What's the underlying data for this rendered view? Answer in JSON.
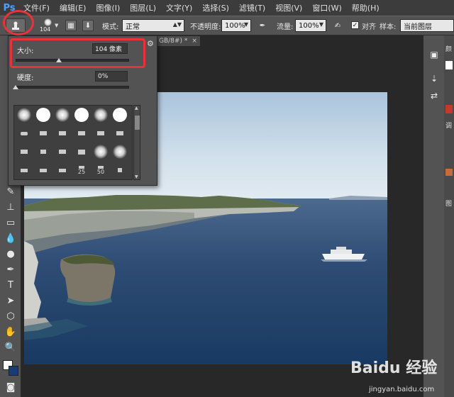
{
  "app": {
    "logo": "Ps"
  },
  "menubar": {
    "items": [
      "文件(F)",
      "编辑(E)",
      "图像(I)",
      "图层(L)",
      "文字(Y)",
      "选择(S)",
      "滤镜(T)",
      "视图(V)",
      "窗口(W)",
      "帮助(H)"
    ]
  },
  "options": {
    "brush_size": "104",
    "mode_label": "模式:",
    "mode_value": "正常",
    "opacity_label": "不透明度:",
    "opacity_value": "100%",
    "flow_label": "流量:",
    "flow_value": "100%",
    "align_label": "对齐",
    "align_checked": "✓",
    "sample_label": "样本:",
    "sample_value": "当前图层"
  },
  "document": {
    "tab_fragment": "GB/8#) *",
    "close": "×"
  },
  "brush_popup": {
    "size_label": "大小:",
    "size_value": "104 像素",
    "size_slider_fraction": 0.38,
    "hardness_label": "硬度:",
    "hardness_value": "0%",
    "hardness_slider_fraction": 0.0,
    "preset_labels": [
      "25",
      "50"
    ]
  },
  "right_panel": {
    "labels": [
      "颜",
      "调",
      "图"
    ]
  },
  "watermark": {
    "text": "Baidu 经验",
    "url": "jingyan.baidu.com"
  },
  "colors": {
    "highlight": "#e8333a",
    "ps_blue": "#4aa3ff",
    "panel": "#535353"
  }
}
